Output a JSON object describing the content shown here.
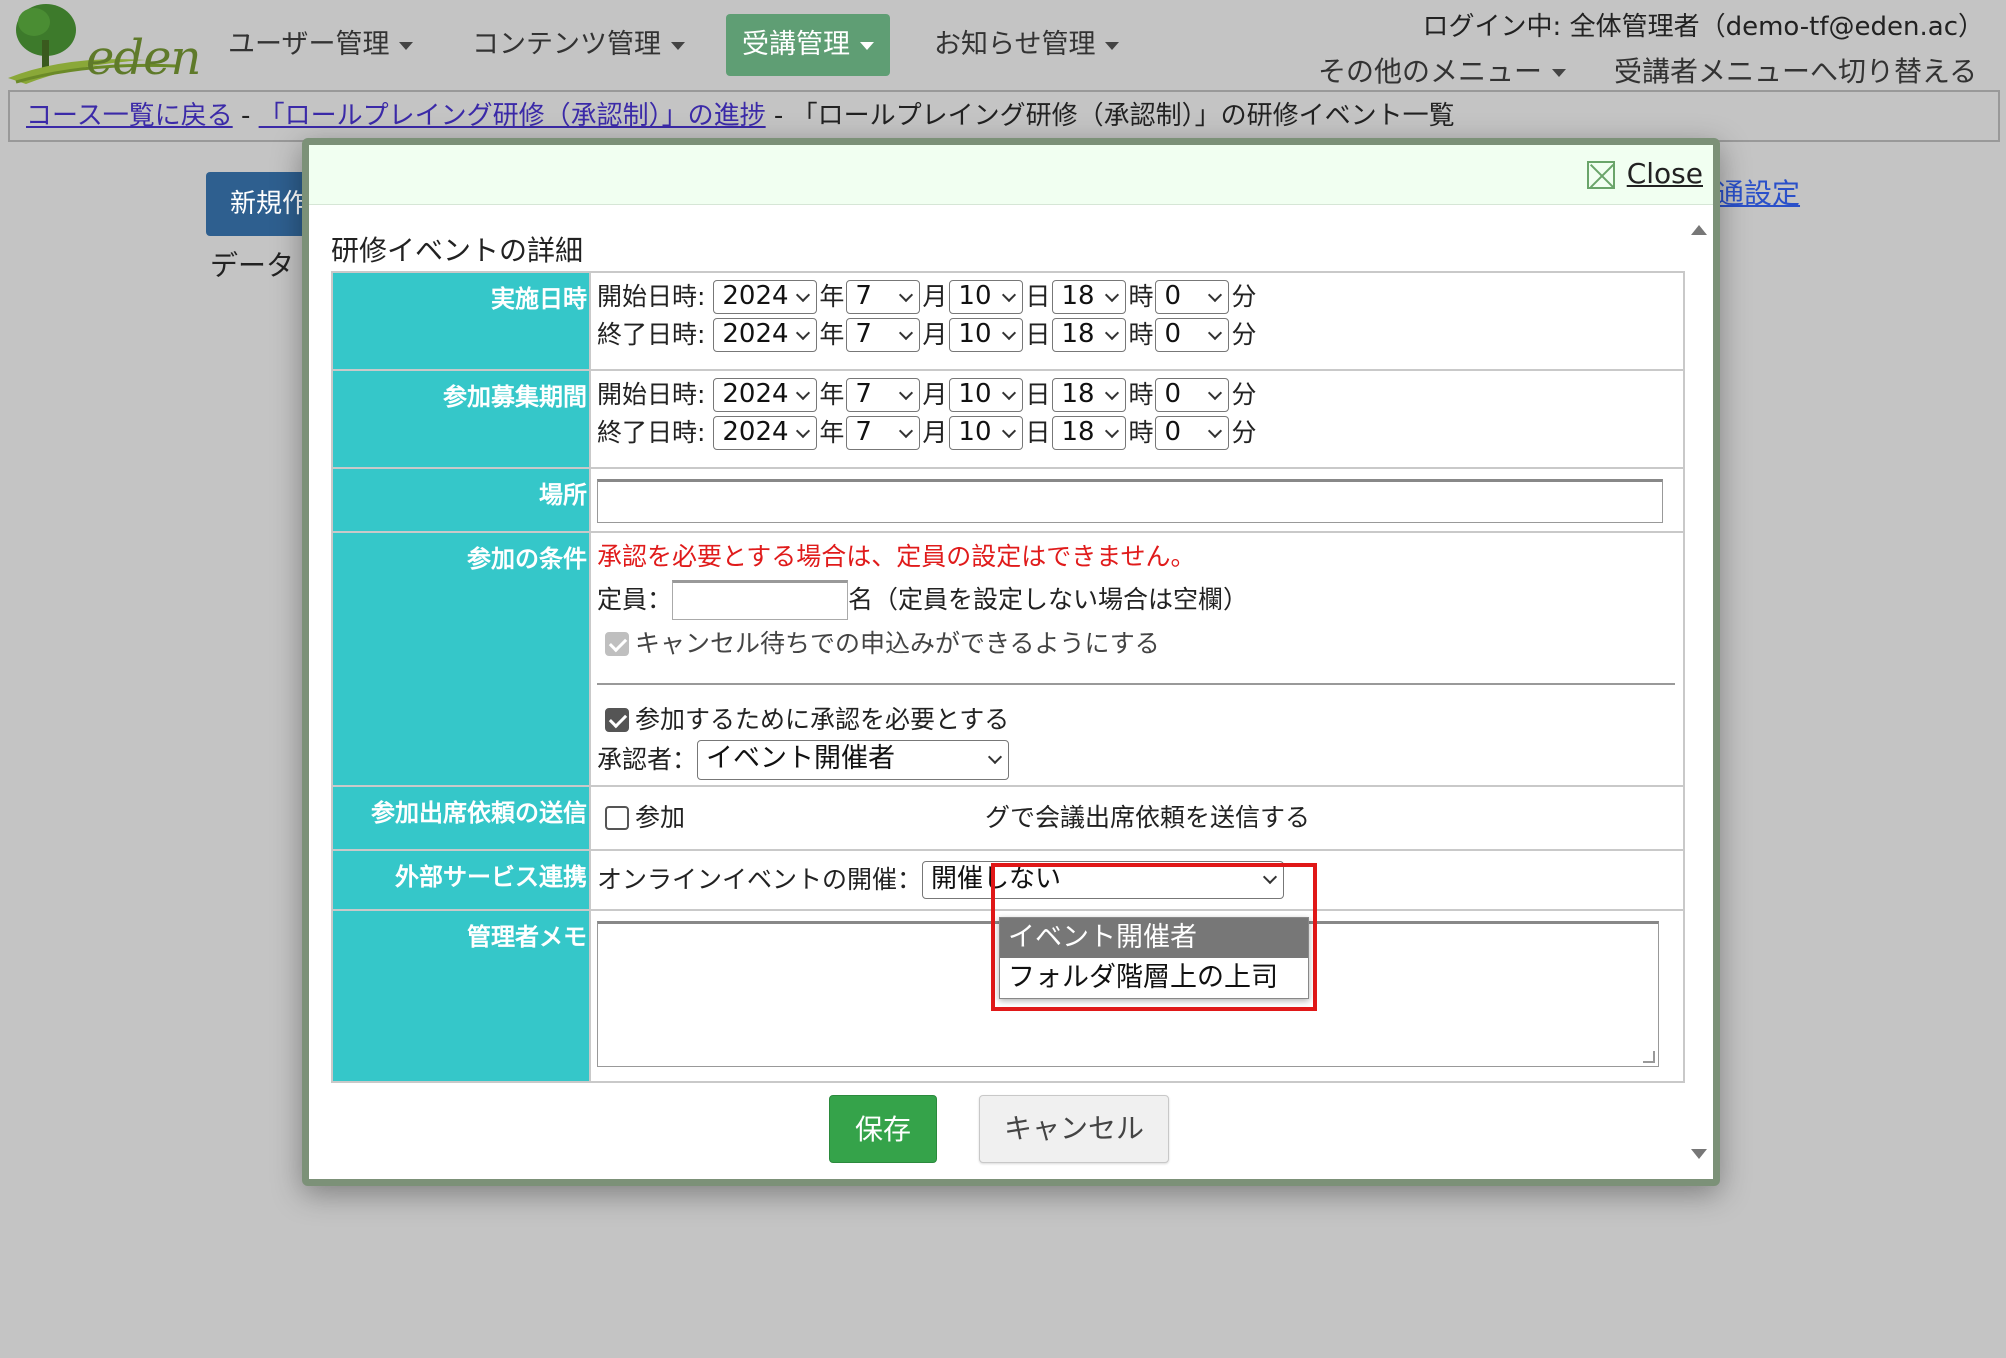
{
  "app": {
    "logo_text": "eden"
  },
  "nav": {
    "users": "ユーザー管理",
    "contents": "コンテンツ管理",
    "courses": "受講管理",
    "notices": "お知らせ管理",
    "other_menu": "その他のメニュー",
    "switch_menu": "受講者メニューへ切り替える",
    "login_status": "ログイン中: 全体管理者（demo-tf@eden.ac）"
  },
  "breadcrumb": {
    "back": "コース一覧に戻る",
    "sep1": " - ",
    "progress": "「ロールプレイング研修（承認制）」の進捗",
    "sep2": " - ",
    "current": "「ロールプレイング研修（承認制）」の研修イベント一覧"
  },
  "background": {
    "new_button": "新規作",
    "data_text": "データ",
    "right_link": "通設定"
  },
  "modal": {
    "close_label": "Close",
    "heading": "研修イベントの詳細",
    "rows": {
      "date": {
        "label": "実施日時",
        "start_label": "開始日時:",
        "end_label": "終了日時:",
        "start": {
          "year": "2024",
          "month": "7",
          "day": "10",
          "hour": "18",
          "minute": "0"
        },
        "end": {
          "year": "2024",
          "month": "7",
          "day": "10",
          "hour": "18",
          "minute": "0"
        }
      },
      "recruit": {
        "label": "参加募集期間",
        "start_label": "開始日時:",
        "end_label": "終了日時:",
        "start": {
          "year": "2024",
          "month": "7",
          "day": "10",
          "hour": "18",
          "minute": "0"
        },
        "end": {
          "year": "2024",
          "month": "7",
          "day": "10",
          "hour": "18",
          "minute": "0"
        }
      },
      "place": {
        "label": "場所",
        "value": ""
      },
      "conditions": {
        "label": "参加の条件",
        "warning": "承認を必要とする場合は、定員の設定はできません。",
        "capacity_label": "定員：",
        "capacity_value": "",
        "capacity_suffix": "名（定員を設定しない場合は空欄）",
        "waitlist_label": "キャンセル待ちでの申込みができるようにする",
        "approval_label": "参加するために承認を必要とする",
        "approver_label": "承認者：",
        "approver_value": "イベント開催者",
        "approver_options": [
          "イベント開催者",
          "フォルダ階層上の上司"
        ]
      },
      "attendance": {
        "label": "参加出席依頼の送信",
        "prefix": "参加",
        "suffix": "グで会議出席依頼を送信する"
      },
      "external": {
        "label": "外部サービス連携",
        "online_label": "オンラインイベントの開催：",
        "online_value": "開催しない"
      },
      "memo": {
        "label": "管理者メモ",
        "value": ""
      }
    },
    "save_label": "保存",
    "cancel_label": "キャンセル"
  },
  "units": {
    "year": "年",
    "month": "月",
    "day": "日",
    "hour": "時",
    "minute": "分"
  },
  "colors": {
    "header_accent": "#5f9e74",
    "label_bg": "#35c7c9",
    "warning": "#e01b1b",
    "save": "#35a34a",
    "highlight": "#e01818"
  }
}
